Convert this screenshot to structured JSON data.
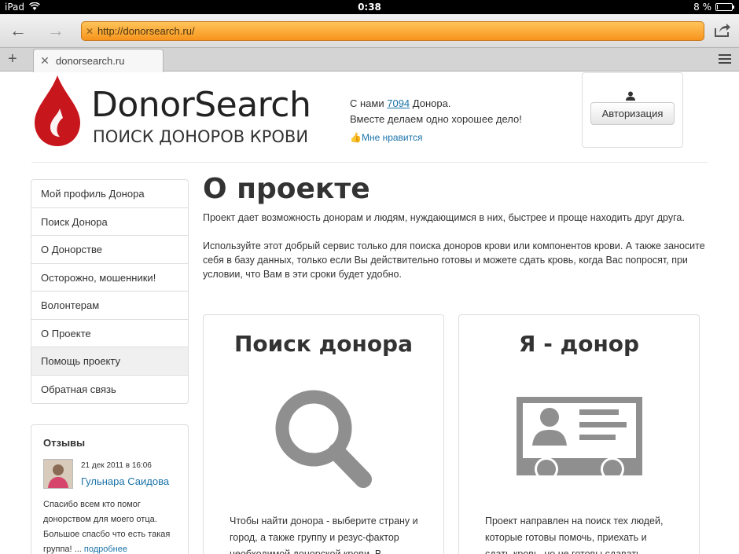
{
  "status_bar": {
    "device": "iPad",
    "time": "0:38",
    "battery": "8 %",
    "battery_level": 0.08
  },
  "browser": {
    "url": "http://donorsearch.ru/",
    "tab_title": "donorsearch.ru"
  },
  "header": {
    "logo_name": "DonorSearch",
    "logo_tagline": "ПОИСК ДОНОРОВ КРОВИ",
    "info_prefix": "С нами",
    "donor_count": "7094",
    "info_suffix": "Донора.",
    "info_line2": "Вместе делаем одно хорошее дело!",
    "like_label": "Мне нравится",
    "auth_button": "Авторизация"
  },
  "sidebar": {
    "items": [
      {
        "label": "Мой профиль Донора"
      },
      {
        "label": "Поиск Донора"
      },
      {
        "label": "О Донорстве"
      },
      {
        "label": "Осторожно, мошенники!"
      },
      {
        "label": "Волонтерам"
      },
      {
        "label": "О Проекте"
      },
      {
        "label": "Помощь проекту"
      },
      {
        "label": "Обратная связь"
      }
    ],
    "reviews": {
      "title": "Отзывы",
      "date": "21 дек 2011 в 16:06",
      "author": "Гульнара Саидова",
      "text": "Спасибо всем кто помог донорством для моего отца. Большое спасбо что есть такая группа! ...",
      "more": "подробнее"
    }
  },
  "main": {
    "title": "О проекте",
    "paragraph1": "Проект дает возможность донорам и людям, нуждающимся в них, быстрее и проще находить друг друга.",
    "paragraph2": "Используйте этот добрый сервис только для поиска доноров крови или компонентов крови. А также заносите себя в базу данных, только если Вы действительно готовы и можете сдать кровь, когда Вас попросят, при условии, что Вам в эти сроки будет удобно.",
    "card_search": {
      "title": "Поиск донора",
      "text": "Чтобы найти донора - выберите страну и город, а также группу и резус-фактор необходимой донорской крови. В",
      "icon": "magnifier-icon"
    },
    "card_donor": {
      "title": "Я - донор",
      "text": "Проект направлен на поиск тех людей, которые готовы помочь, приехать и сдать кровь, но не готовы сдавать",
      "icon": "id-card-icon"
    }
  },
  "colors": {
    "brand_red": "#c8161d",
    "link": "#1a73a8",
    "url_bar": "#f7941d"
  }
}
